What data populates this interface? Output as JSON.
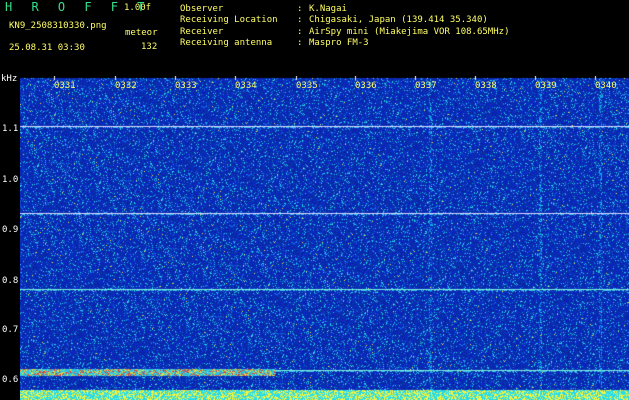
{
  "header": {
    "app_title": "H R O F F T",
    "app_version": "1.00f",
    "file_name": "KN9_2508310330.png",
    "timestamp": "25.08.31 03:30",
    "mode": "meteor",
    "count": "132"
  },
  "metadata": [
    {
      "key": "Observer",
      "sep": ":",
      "value": "K.Nagai"
    },
    {
      "key": "Receiving Location",
      "sep": ":",
      "value": "Chigasaki, Japan (139.414 35.340)"
    },
    {
      "key": "Receiver",
      "sep": ":",
      "value": "AirSpy mini (Miakejima VOR 108.65MHz)"
    },
    {
      "key": "Receiving antenna",
      "sep": ":",
      "value": "Maspro FM-3"
    }
  ],
  "axis": {
    "unit": "kHz",
    "y_labels": [
      "1.1",
      "1.0",
      "0.9",
      "0.8",
      "0.7",
      "0.6"
    ],
    "x_labels": [
      "0331",
      "0332",
      "0333",
      "0334",
      "0335",
      "0336",
      "0337",
      "0338",
      "0339",
      "0340"
    ]
  },
  "colors": {
    "background": "#000000",
    "text_header": "#ffff66",
    "text_title": "#35e08a",
    "text_axis": "#ffffff",
    "spectrogram_base": "#0a20b4"
  }
}
